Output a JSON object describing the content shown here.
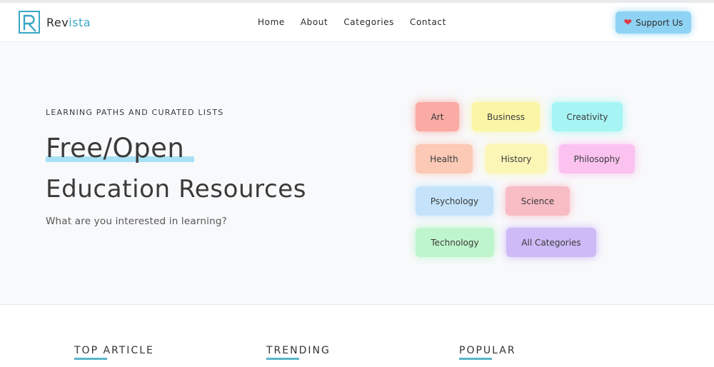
{
  "brand": {
    "name_prefix": "Rev",
    "name_suffix": "ista",
    "accent_color": "#3aa6c7"
  },
  "nav": {
    "items": [
      {
        "label": "Home"
      },
      {
        "label": "About"
      },
      {
        "label": "Categories"
      },
      {
        "label": "Contact"
      }
    ]
  },
  "support_button": {
    "label": "Support Us",
    "icon": "heart-icon",
    "color": "#8fd3f4"
  },
  "hero": {
    "eyebrow": "LEARNING PATHS AND CURATED LISTS",
    "title_line1": "Free/Open",
    "title_line2": "Education Resources",
    "subtitle": "What are you interested in learning?"
  },
  "categories": [
    {
      "label": "Art",
      "color": "#f9aba4"
    },
    {
      "label": "Business",
      "color": "#fbf6a6"
    },
    {
      "label": "Creativity",
      "color": "#a6f5f4"
    },
    {
      "label": "Health",
      "color": "#fbc9b6"
    },
    {
      "label": "History",
      "color": "#fbf6b6"
    },
    {
      "label": "Philosophy",
      "color": "#fbc2f0"
    },
    {
      "label": "Psychology",
      "color": "#c4e3fa"
    },
    {
      "label": "Science",
      "color": "#f8bcc4"
    },
    {
      "label": "Technology",
      "color": "#bff5cc"
    },
    {
      "label": "All Categories",
      "color": "#cdbaf6"
    }
  ],
  "sections": [
    {
      "label": "TOP ARTICLE"
    },
    {
      "label": "TRENDING"
    },
    {
      "label": "POPULAR"
    }
  ]
}
